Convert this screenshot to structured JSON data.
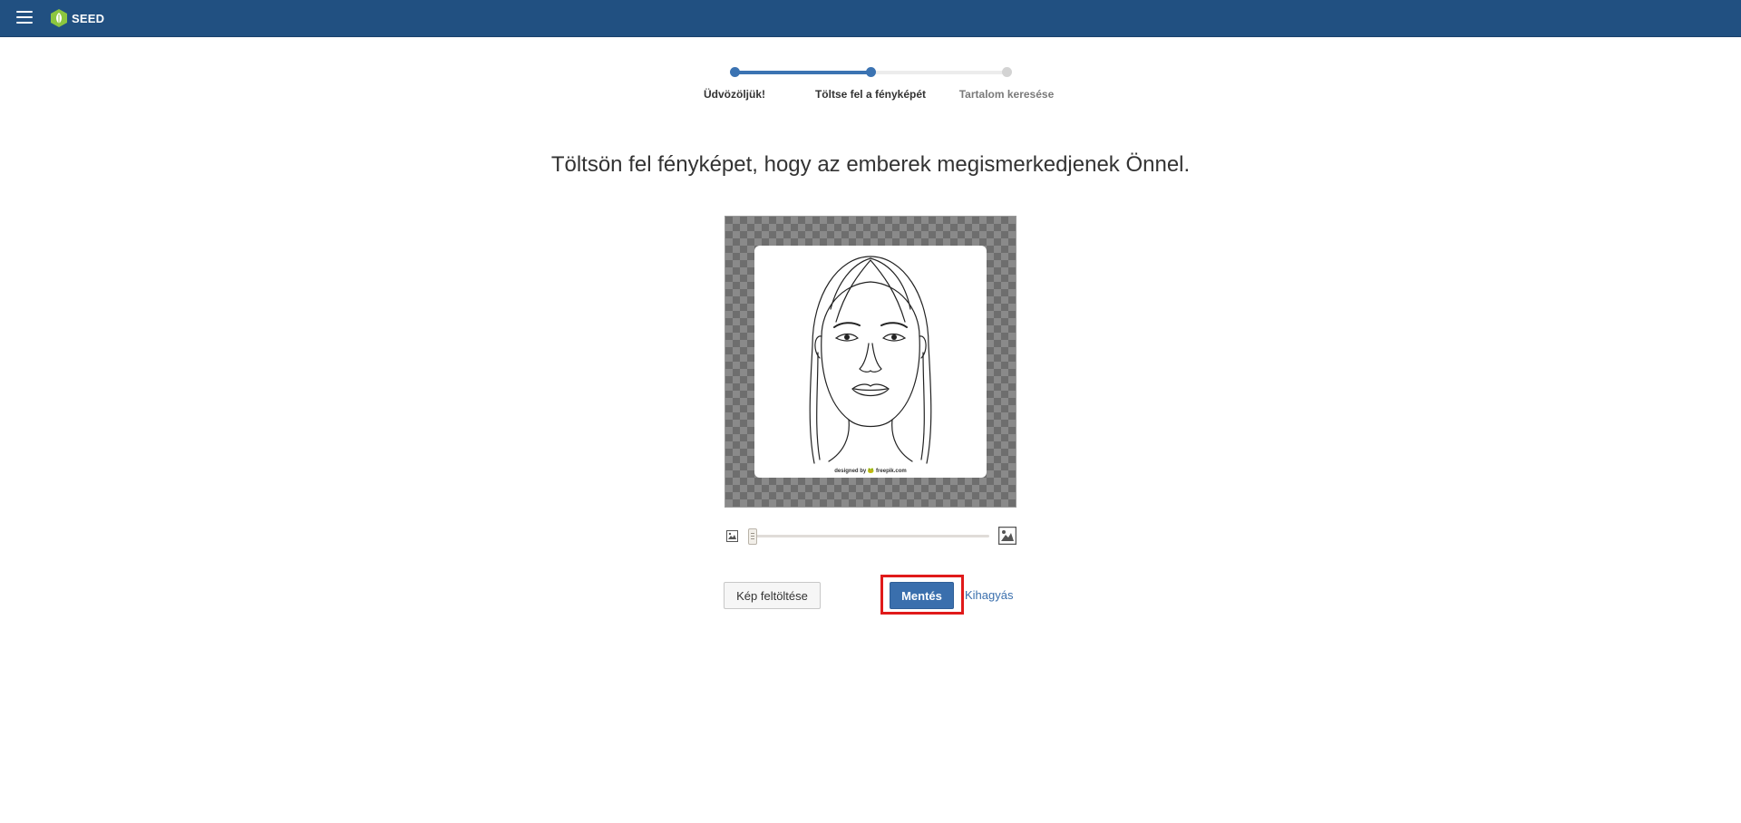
{
  "header": {
    "brand": "SEED",
    "menu_icon": "hamburger-icon",
    "logo_icon": "leaf-hexagon-icon",
    "brand_color": "#215081",
    "logo_color": "#8cc63f"
  },
  "stepper": {
    "steps": [
      {
        "label": "Üdvözöljük!",
        "state": "done"
      },
      {
        "label": "Töltse fel a fényképét",
        "state": "current"
      },
      {
        "label": "Tartalom keresése",
        "state": "todo"
      }
    ]
  },
  "main": {
    "heading": "Töltsön fel fényképet, hogy az emberek megismerkedjenek Önnel.",
    "photo_credit": "designed by 🐸 freepik.com",
    "zoom": {
      "small_icon": "image-small-icon",
      "large_icon": "image-large-icon",
      "value": 0.0
    }
  },
  "actions": {
    "upload_label": "Kép feltöltése",
    "save_label": "Mentés",
    "skip_label": "Kihagyás",
    "highlight_color": "#e01a1a",
    "accent": "#3a6fad"
  }
}
